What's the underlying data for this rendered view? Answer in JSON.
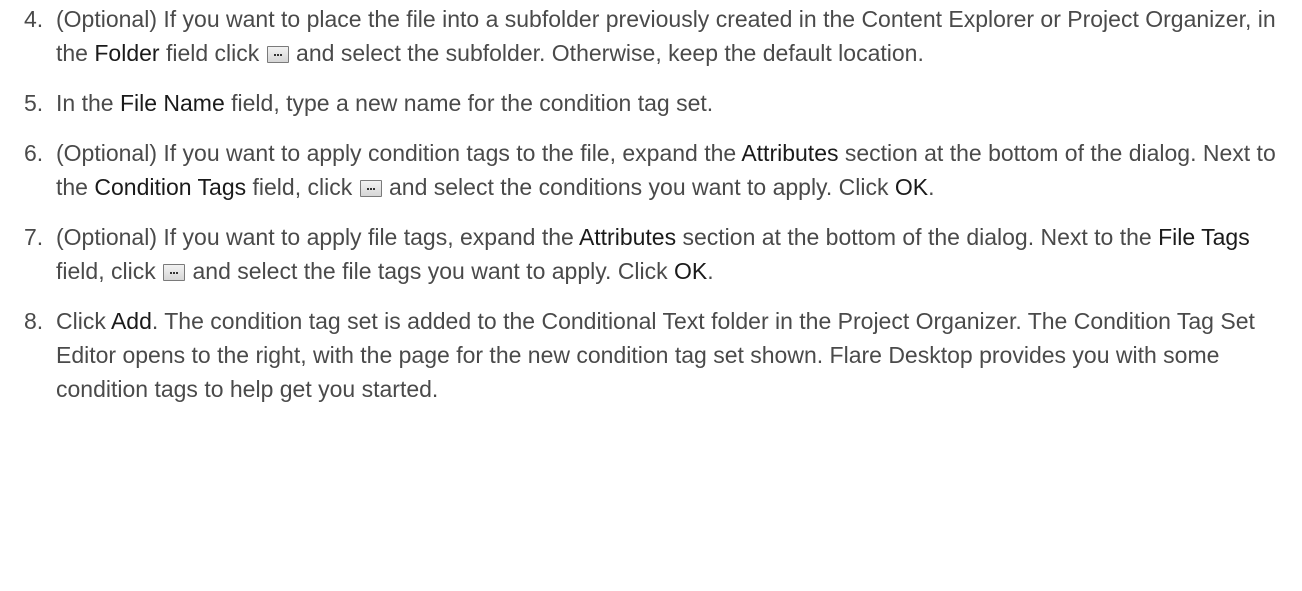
{
  "steps": [
    {
      "number": "4.",
      "parts": [
        {
          "text": "(Optional) If you want to place the file into a subfolder previously created in the Content Explorer or Project Organizer, in the "
        },
        {
          "text": "Folder",
          "ui": true
        },
        {
          "text": " field click "
        },
        {
          "icon": "browse-icon"
        },
        {
          "text": " and select the subfolder. Otherwise, keep the default location."
        }
      ]
    },
    {
      "number": "5.",
      "parts": [
        {
          "text": "In the "
        },
        {
          "text": "File Name",
          "ui": true
        },
        {
          "text": " field, type a new name for the condition tag set."
        }
      ]
    },
    {
      "number": "6.",
      "parts": [
        {
          "text": "(Optional) If you want to apply condition tags to the file, expand the "
        },
        {
          "text": "Attributes",
          "ui": true
        },
        {
          "text": " section at the bottom of the dialog. Next to the "
        },
        {
          "text": "Condition Tags",
          "ui": true
        },
        {
          "text": " field, click "
        },
        {
          "icon": "browse-icon"
        },
        {
          "text": " and select the conditions you want to apply. Click "
        },
        {
          "text": "OK",
          "ui": true
        },
        {
          "text": "."
        }
      ]
    },
    {
      "number": "7.",
      "parts": [
        {
          "text": "(Optional) If you want to apply file tags, expand the "
        },
        {
          "text": "Attributes",
          "ui": true
        },
        {
          "text": " section at the bottom of the dialog. Next to the "
        },
        {
          "text": "File Tags",
          "ui": true
        },
        {
          "text": " field, click "
        },
        {
          "icon": "browse-icon"
        },
        {
          "text": " and select the file tags you want to apply. Click "
        },
        {
          "text": "OK",
          "ui": true
        },
        {
          "text": "."
        }
      ]
    },
    {
      "number": "8.",
      "parts": [
        {
          "text": "Click "
        },
        {
          "text": "Add",
          "ui": true
        },
        {
          "text": ". The condition tag set is added to the Conditional Text folder in the Project Organizer. The Condition Tag Set Editor opens to the right, with the page for the new condition tag set shown. Flare Desktop provides you with some condition tags to help get you started."
        }
      ]
    }
  ]
}
